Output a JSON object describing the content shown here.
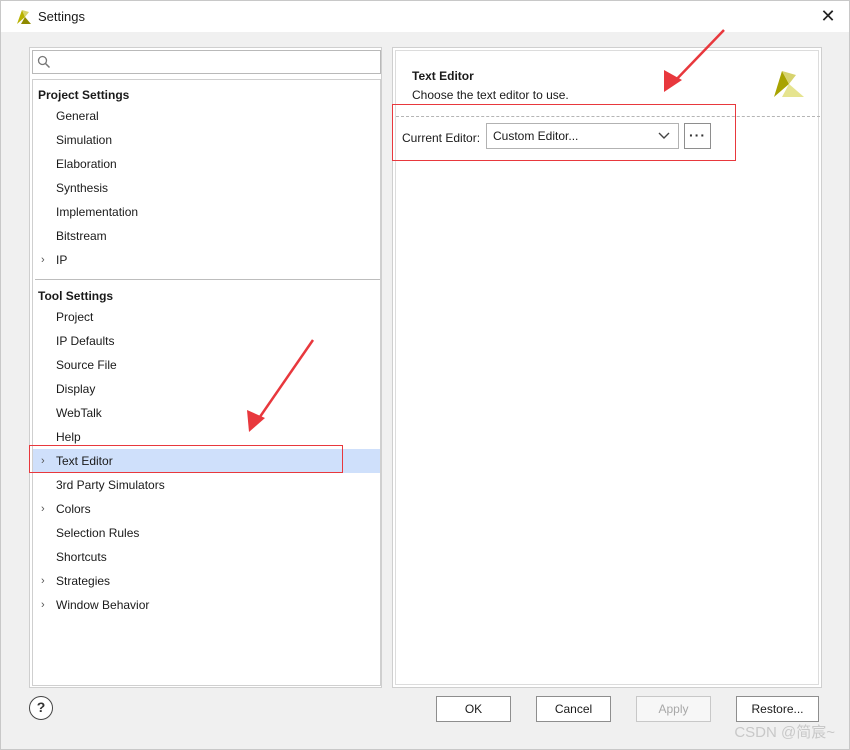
{
  "window": {
    "title": "Settings",
    "close_glyph": "✕",
    "accent_color": "#cfe0fb",
    "annotation_color": "#e8383d"
  },
  "search": {
    "placeholder": "",
    "value": ""
  },
  "project_settings": {
    "header": "Project Settings",
    "items": [
      {
        "label": "General",
        "expandable": false
      },
      {
        "label": "Simulation",
        "expandable": false
      },
      {
        "label": "Elaboration",
        "expandable": false
      },
      {
        "label": "Synthesis",
        "expandable": false
      },
      {
        "label": "Implementation",
        "expandable": false
      },
      {
        "label": "Bitstream",
        "expandable": false
      },
      {
        "label": "IP",
        "expandable": true
      }
    ]
  },
  "tool_settings": {
    "header": "Tool Settings",
    "items": [
      {
        "label": "Project",
        "expandable": false
      },
      {
        "label": "IP Defaults",
        "expandable": false
      },
      {
        "label": "Source File",
        "expandable": false
      },
      {
        "label": "Display",
        "expandable": false
      },
      {
        "label": "WebTalk",
        "expandable": false
      },
      {
        "label": "Help",
        "expandable": false
      },
      {
        "label": "Text Editor",
        "expandable": true,
        "selected": true
      },
      {
        "label": "3rd Party Simulators",
        "expandable": false
      },
      {
        "label": "Colors",
        "expandable": true
      },
      {
        "label": "Selection Rules",
        "expandable": false
      },
      {
        "label": "Shortcuts",
        "expandable": false
      },
      {
        "label": "Strategies",
        "expandable": true
      },
      {
        "label": "Window Behavior",
        "expandable": true
      }
    ]
  },
  "panel": {
    "title": "Text Editor",
    "subtitle": "Choose the text editor to use.",
    "editor_label": "Current Editor:",
    "editor_value": "Custom Editor...",
    "browse_label": "···"
  },
  "footer": {
    "help_label": "?",
    "ok_label": "OK",
    "cancel_label": "Cancel",
    "apply_label": "Apply",
    "restore_label": "Restore..."
  },
  "watermark": "CSDN @简宸~",
  "icons": {
    "chevron": "chevron-right-icon",
    "search": "search-icon",
    "dropdown": "chevron-down-icon",
    "logo": "brand-logo-icon"
  }
}
